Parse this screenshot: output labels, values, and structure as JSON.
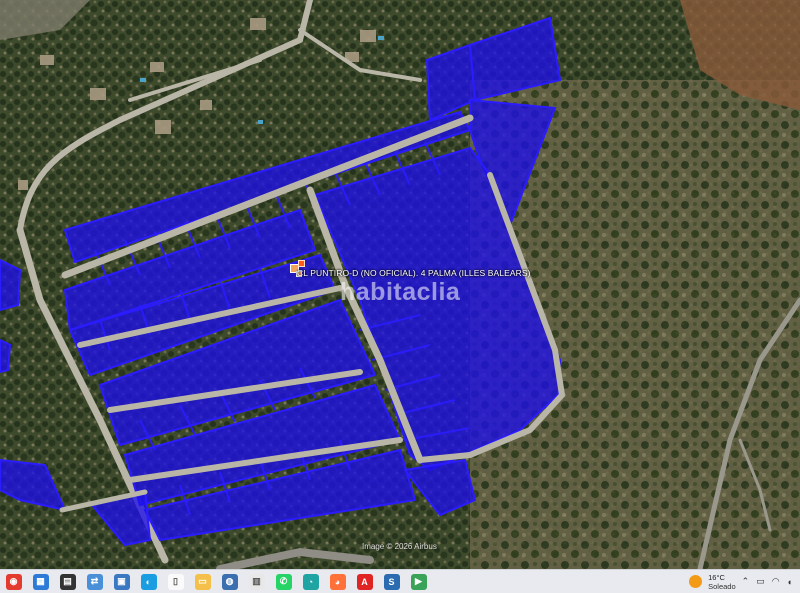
{
  "map": {
    "address_label": "CL PUNTIRO-D (NO OFICIAL). 4  PALMA (ILLES BALEARS)",
    "watermark": "habitaclia",
    "imagery_credit": "Image © 2026 Airbus",
    "overlay_color": "#1e10e8",
    "overlay_stroke": "#2b1cff",
    "road_color": "#b9b6a8"
  },
  "taskbar": {
    "apps": [
      {
        "name": "chrome-icon",
        "color": "#e33b2e",
        "glyph": "◉"
      },
      {
        "name": "app-icon-1",
        "color": "#2d7bd6",
        "glyph": "▦"
      },
      {
        "name": "media-icon",
        "color": "#333",
        "glyph": "▤"
      },
      {
        "name": "sync-icon",
        "color": "#4a90d9",
        "glyph": "⇄"
      },
      {
        "name": "photos-icon",
        "color": "#3a78c2",
        "glyph": "▣"
      },
      {
        "name": "edge-icon",
        "color": "#1b9de2",
        "glyph": "◐"
      },
      {
        "name": "document-icon",
        "color": "#fafafa",
        "glyph": "▯"
      },
      {
        "name": "file-explorer-icon",
        "color": "#f5c04a",
        "glyph": "▭"
      },
      {
        "name": "globe-icon",
        "color": "#3c6fb0",
        "glyph": "◍"
      },
      {
        "name": "store-icon",
        "color": "#e8e8e8",
        "glyph": "▥"
      },
      {
        "name": "whatsapp-icon",
        "color": "#25d366",
        "glyph": "✆"
      },
      {
        "name": "app-icon-2",
        "color": "#1fa3a3",
        "glyph": "◔"
      },
      {
        "name": "firefox-icon",
        "color": "#ff7139",
        "glyph": "◕"
      },
      {
        "name": "acrobat-icon",
        "color": "#e02424",
        "glyph": "A"
      },
      {
        "name": "app-icon-3",
        "color": "#2b6cb0",
        "glyph": "S"
      },
      {
        "name": "app-icon-4",
        "color": "#3aa357",
        "glyph": "▶"
      }
    ],
    "weather": {
      "temp": "16°C",
      "desc": "Soleado"
    }
  }
}
